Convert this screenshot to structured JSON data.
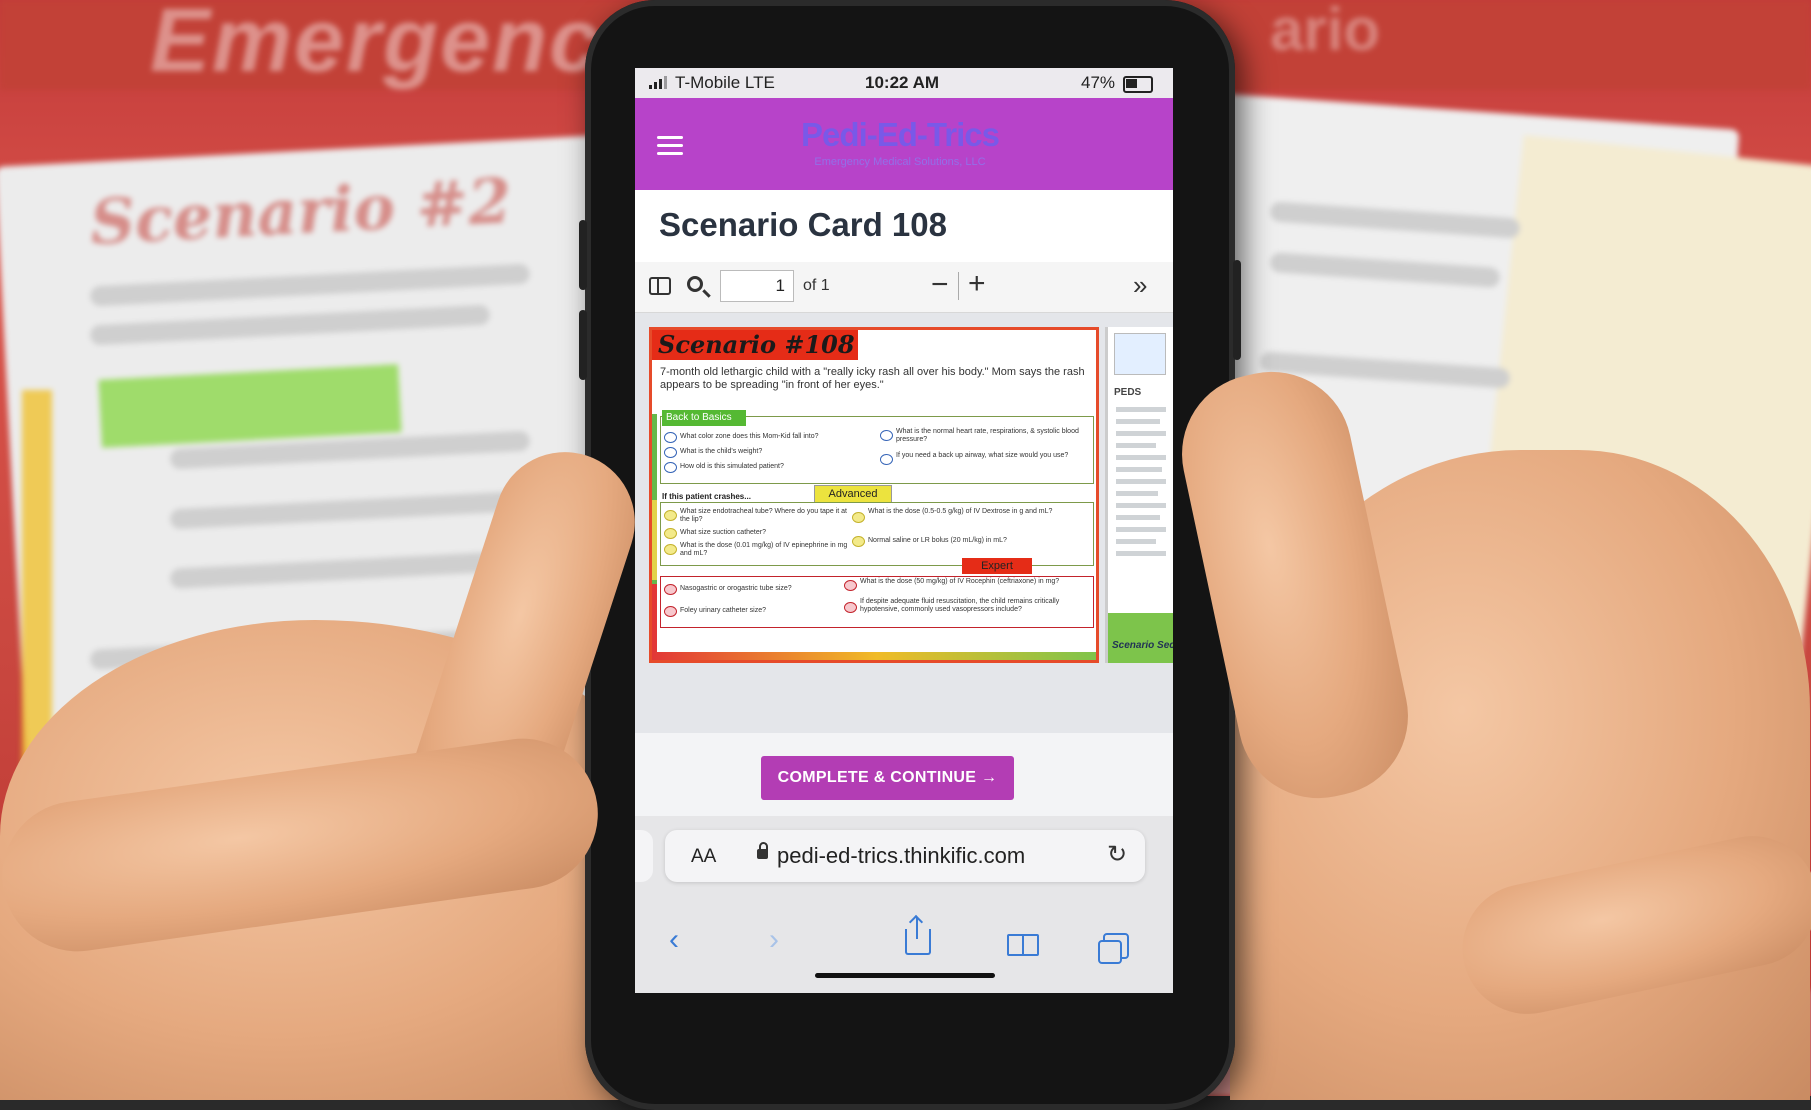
{
  "background": {
    "card_left_title": "Scenario #2",
    "top_banner_text": "Emergenc",
    "top_banner_text_right": "ario"
  },
  "phone": {
    "status_bar": {
      "carrier": "T-Mobile  LTE",
      "time": "10:22 AM",
      "battery": "47%"
    },
    "brand": {
      "logo": "Pedi-Ed-Trics",
      "tagline": "Emergency Medical Solutions, LLC"
    },
    "page_title": "Scenario Card 108",
    "pdf_toolbar": {
      "page_current": "1",
      "page_total": "of 1",
      "zoom_out": "−",
      "zoom_in": "+",
      "more": "»"
    },
    "pdf_card": {
      "title": "Scenario #108",
      "description": "7-month old lethargic child with a \"really icky rash all over his body.\" Mom says the rash appears to be spreading \"in front of her eyes.\"",
      "tag_basics": "Back to Basics",
      "tag_advanced": "Advanced",
      "tag_expert": "Expert",
      "crash_heading": "If this patient crashes...",
      "questions_basic": [
        {
          "letter": "A",
          "text": "What color zone does this Mom-Kid fall into?"
        },
        {
          "letter": "B",
          "text": "What is the child's weight?"
        },
        {
          "letter": "C",
          "text": "How old is this simulated patient?"
        },
        {
          "letter": "D",
          "text": "What is the normal heart rate, respirations, & systolic blood pressure?"
        },
        {
          "letter": "E",
          "text": "If you need a back up airway, what size would you use?"
        }
      ],
      "questions_advanced": [
        {
          "letter": "F",
          "text": "What size endotracheal tube? Where do you tape it at the lip?"
        },
        {
          "letter": "G",
          "text": "What size suction catheter?"
        },
        {
          "letter": "H",
          "text": "What is the dose (0.01 mg/kg) of IV epinephrine in mg and mL?"
        },
        {
          "letter": "I",
          "text": "What is the dose (0.5-0.5 g/kg) of IV Dextrose in g and mL?"
        },
        {
          "letter": "J",
          "text": "Normal saline or LR bolus (20 mL/kg) in mL?"
        }
      ],
      "questions_expert": [
        {
          "letter": "K",
          "text": "Nasogastric or orogastric tube size?"
        },
        {
          "letter": "L",
          "text": "Foley urinary catheter size?"
        },
        {
          "letter": "M",
          "text": "What is the dose (50 mg/kg) of IV Rocephin (ceftriaxone) in mg?"
        },
        {
          "letter": "N",
          "text": "If despite adequate fluid resuscitation, the child remains critically hypotensive, commonly used vasopressors include?"
        }
      ],
      "side_label": "PEDS",
      "side_green_label": "Scenario Sec"
    },
    "continue_button": "COMPLETE & CONTINUE →",
    "url_bar": {
      "aa": "AA",
      "url": "pedi-ed-trics.thinkific.com",
      "reload": "↻"
    },
    "safari_toolbar": {
      "back": "‹",
      "forward": "›"
    }
  },
  "colors": {
    "brand_purple": "#b743c9",
    "button_purple": "#b33db4",
    "scenario_red": "#e52c17",
    "basics_green": "#55b933",
    "advanced_yellow": "#ece33e",
    "safari_blue": "#3a7bd5"
  }
}
